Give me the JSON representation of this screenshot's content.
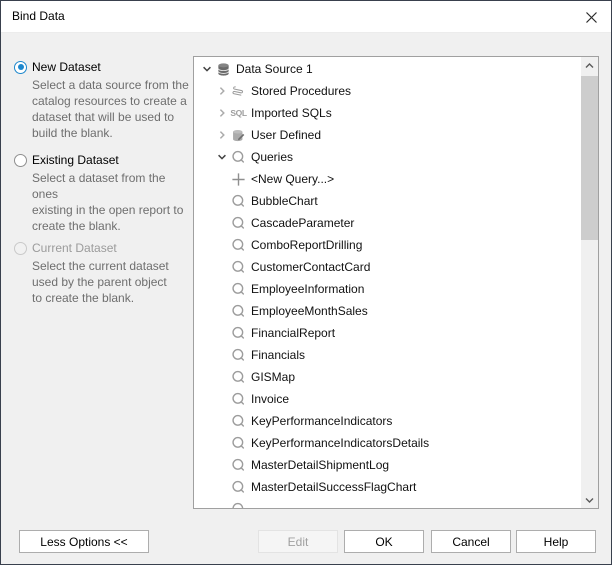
{
  "window": {
    "title": "Bind Data"
  },
  "options": [
    {
      "label": "New Dataset",
      "description": "Select a data source from the\ncatalog resources to create a\ndataset that will be used to\nbuild the blank.",
      "selected": true,
      "enabled": true
    },
    {
      "label": "Existing Dataset",
      "description": "Select a dataset from the ones\nexisting in the open report to\ncreate the blank.",
      "selected": false,
      "enabled": true
    },
    {
      "label": "Current Dataset",
      "description": "Select the current dataset\nused by the parent object\nto create the blank.",
      "selected": false,
      "enabled": false
    }
  ],
  "tree": {
    "items": [
      {
        "label": "Data Source 1",
        "level": 0,
        "icon": "database-icon",
        "expander": "expanded"
      },
      {
        "label": "Stored Procedures",
        "level": 1,
        "icon": "scroll-icon",
        "expander": "collapsed"
      },
      {
        "label": "Imported SQLs",
        "level": 1,
        "icon": "sql-icon",
        "expander": "collapsed"
      },
      {
        "label": "User Defined",
        "level": 1,
        "icon": "database-edit-icon",
        "expander": "collapsed"
      },
      {
        "label": "Queries",
        "level": 1,
        "icon": "query-icon",
        "expander": "expanded"
      },
      {
        "label": "<New Query...>",
        "level": 2,
        "icon": "plus-icon",
        "expander": "none"
      },
      {
        "label": "BubbleChart",
        "level": 2,
        "icon": "query-icon",
        "expander": "none"
      },
      {
        "label": "CascadeParameter",
        "level": 2,
        "icon": "query-icon",
        "expander": "none"
      },
      {
        "label": "ComboReportDrilling",
        "level": 2,
        "icon": "query-icon",
        "expander": "none"
      },
      {
        "label": "CustomerContactCard",
        "level": 2,
        "icon": "query-icon",
        "expander": "none"
      },
      {
        "label": "EmployeeInformation",
        "level": 2,
        "icon": "query-icon",
        "expander": "none"
      },
      {
        "label": "EmployeeMonthSales",
        "level": 2,
        "icon": "query-icon",
        "expander": "none"
      },
      {
        "label": "FinancialReport",
        "level": 2,
        "icon": "query-icon",
        "expander": "none"
      },
      {
        "label": "Financials",
        "level": 2,
        "icon": "query-icon",
        "expander": "none"
      },
      {
        "label": "GISMap",
        "level": 2,
        "icon": "query-icon",
        "expander": "none"
      },
      {
        "label": "Invoice",
        "level": 2,
        "icon": "query-icon",
        "expander": "none"
      },
      {
        "label": "KeyPerformanceIndicators",
        "level": 2,
        "icon": "query-icon",
        "expander": "none"
      },
      {
        "label": "KeyPerformanceIndicatorsDetails",
        "level": 2,
        "icon": "query-icon",
        "expander": "none"
      },
      {
        "label": "MasterDetailShipmentLog",
        "level": 2,
        "icon": "query-icon",
        "expander": "none"
      },
      {
        "label": "MasterDetailSuccessFlagChart",
        "level": 2,
        "icon": "query-icon",
        "expander": "none"
      },
      {
        "label": "",
        "level": 2,
        "icon": "query-icon",
        "expander": "none",
        "partial": true
      }
    ]
  },
  "buttons": {
    "less_options": "Less Options <<",
    "edit": "Edit",
    "ok": "OK",
    "cancel": "Cancel",
    "help": "Help"
  },
  "colors": {
    "accent": "#1d87cd",
    "dialog-bg": "#f0f0f0",
    "titlebar-bg": "#ffffff",
    "window-border": "#39404d",
    "panel-border": "#a0a0a0",
    "icon-gray": "#9c9c9c",
    "icon-dark": "#6a6a6a",
    "text": "#000000",
    "text2": "#6e6e6e",
    "disabled-text": "#9b9b9b",
    "button-border": "#adadad",
    "sb-thumb": "#cdcdcd",
    "sb-track": "#f0f0f0"
  }
}
